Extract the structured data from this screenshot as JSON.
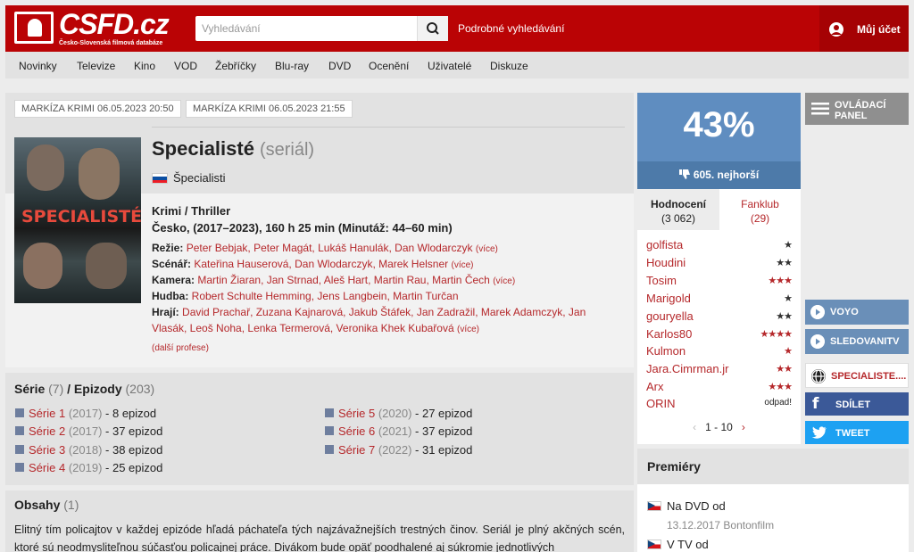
{
  "header": {
    "logo_name": "CSFD.cz",
    "logo_sub": "Česko-Slovenská filmová databáze",
    "search_placeholder": "Vyhledávání",
    "advanced_search": "Podrobné vyhledávání",
    "account": "Můj účet"
  },
  "nav": [
    "Novinky",
    "Televize",
    "Kino",
    "VOD",
    "Žebříčky",
    "Blu-ray",
    "DVD",
    "Ocenění",
    "Uživatelé",
    "Diskuze"
  ],
  "tv_tags": [
    "MARKÍZA KRIMI 06.05.2023 20:50",
    "MARKÍZA KRIMI 06.05.2023 21:55"
  ],
  "film": {
    "poster_title": "SPECIALISTÉ",
    "title": "Specialisté",
    "kind": "(seriál)",
    "alt_name": "Špecialisti",
    "genre": "Krimi / Thriller",
    "origin": "Česko, (2017–2023), 160 h 25 min (Minutáž: 44–60 min)",
    "vice": "(více)",
    "more_professions": "(další profese)",
    "crew": [
      {
        "label": "Režie:",
        "names": "Peter Bebjak, Peter Magát, Lukáš Hanulák, Dan Wlodarczyk"
      },
      {
        "label": "Scénář:",
        "names": "Kateřina Hauserová, Dan Wlodarczyk, Marek Helsner"
      },
      {
        "label": "Kamera:",
        "names": "Martin Žiaran, Jan Strnad, Aleš Hart, Martin Rau, Martin Čech"
      },
      {
        "label": "Hudba:",
        "names": "Robert Schulte Hemming, Jens Langbein, Martin Turčan"
      },
      {
        "label": "Hrají:",
        "names": "David Prachař, Zuzana Kajnarová, Jakub Štáfek, Jan Zadražil, Marek Adamczyk, Jan",
        "names2": "Vlasák, Leoš Noha, Lenka Termerová, Veronika Khek Kubařová"
      }
    ]
  },
  "series": {
    "label": "Série",
    "count": "(7)",
    "ep_label": "/ Epizody",
    "ep_count": "(203)",
    "items": [
      {
        "name": "Série 1",
        "year": "(2017)",
        "eps": "- 8 epizod"
      },
      {
        "name": "Série 2",
        "year": "(2017)",
        "eps": "- 37 epizod"
      },
      {
        "name": "Série 3",
        "year": "(2018)",
        "eps": "- 38 epizod"
      },
      {
        "name": "Série 4",
        "year": "(2019)",
        "eps": "- 25 epizod"
      },
      {
        "name": "Série 5",
        "year": "(2020)",
        "eps": "- 27 epizod"
      },
      {
        "name": "Série 6",
        "year": "(2021)",
        "eps": "- 37 epizod"
      },
      {
        "name": "Série 7",
        "year": "(2022)",
        "eps": "- 31 epizod"
      }
    ]
  },
  "obsah": {
    "label": "Obsahy",
    "count": "(1)",
    "text": "Elitný tím policajtov v každej epizóde hľadá páchateľa tých najzávažnejších trestných činov. Seriál je plný akčných scén, ktoré sú neodmysliteľnou súčasťou policajnej práce. Divákom bude opäť poodhalené aj súkromie jednotlivých"
  },
  "rating": {
    "percent": "43%",
    "rank": "605. nejhorší",
    "tab_ratings": "Hodnocení",
    "tab_ratings_count": "(3 062)",
    "tab_fanclub": "Fanklub",
    "tab_fanclub_count": "(29)",
    "users": [
      {
        "name": "golfista",
        "stars": "★",
        "dark": true
      },
      {
        "name": "Houdini",
        "stars": "★★",
        "dark": true
      },
      {
        "name": "Tosim",
        "stars": "★★★",
        "dark": false
      },
      {
        "name": "Marigold",
        "stars": "★",
        "dark": true
      },
      {
        "name": "gouryella",
        "stars": "★★",
        "dark": true
      },
      {
        "name": "Karlos80",
        "stars": "★★★★",
        "dark": false
      },
      {
        "name": "Kulmon",
        "stars": "★",
        "dark": false
      },
      {
        "name": "Jara.Cimrman.jr",
        "stars": "★★",
        "dark": false
      },
      {
        "name": "Arx",
        "stars": "★★★",
        "dark": false
      },
      {
        "name": "ORIN",
        "stars": "odpad!",
        "dark": true
      }
    ],
    "pager": "1 - 10",
    "prev": "‹",
    "next": "›"
  },
  "premiery": {
    "title": "Premiéry",
    "rows": [
      {
        "label": "Na DVD od",
        "sub": "13.12.2017 Bontonfilm"
      },
      {
        "label": "V TV od",
        "sub": ""
      }
    ]
  },
  "side": {
    "control_panel": "OVLÁDACÍ PANEL",
    "voyo": "VOYO",
    "sledovanitv": "SLEDOVANITV",
    "web": "SPECIALISTE....",
    "share": "SDÍLET",
    "tweet": "TWEET"
  },
  "colors": {
    "brand": "#ba0305",
    "rating": "#5f8dc0",
    "link": "#b5282b"
  }
}
